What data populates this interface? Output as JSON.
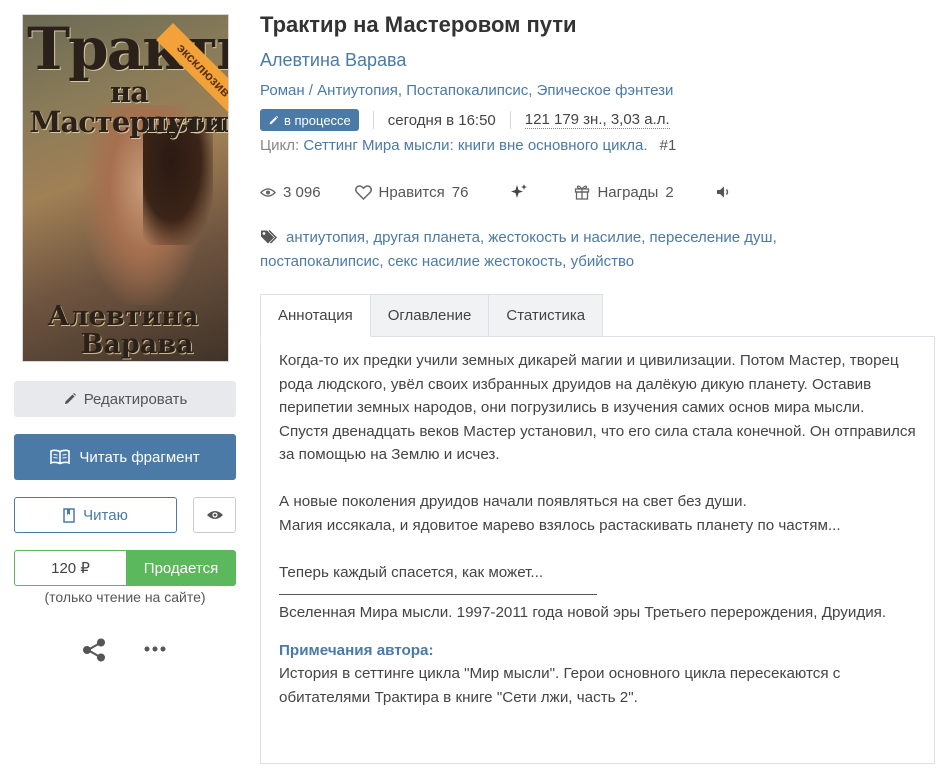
{
  "book": {
    "title": "Трактир на Мастеровом пути",
    "author": "Алевтина Варава",
    "genres": [
      "Роман",
      "Антиутопия",
      "Постапокалипсис",
      "Эпическое фэнтези"
    ],
    "status": "в процессе",
    "updated": "сегодня в 16:50",
    "size": "121 179 зн., 3,03 а.л.",
    "cycle_label": "Цикл:",
    "cycle_name": "Сеттинг Мира мысли: книги вне основного цикла.",
    "cycle_num": "#1"
  },
  "cover": {
    "line1": "Трактир",
    "line2": "на Мастеровом",
    "line3": "пути",
    "author1": "Алевтина",
    "author2": "Варава",
    "ribbon": "эксклюзив"
  },
  "stats": {
    "views": "3 096",
    "likes_label": "Нравится",
    "likes": "76",
    "awards_label": "Награды",
    "awards": "2"
  },
  "tags": [
    "антиутопия",
    "другая планета",
    "жестокость и насилие",
    "переселение душ",
    "постапокалипсис",
    "секс насилие жестокость",
    "убийство"
  ],
  "actions": {
    "edit": "Редактировать",
    "read_fragment": "Читать фрагмент",
    "reading": "Читаю",
    "price": "120 ₽",
    "buy": "Продается",
    "price_note": "(только чтение на сайте)"
  },
  "tabs": [
    "Аннотация",
    "Оглавление",
    "Статистика"
  ],
  "annotation": {
    "p1": "Когда-то их предки учили земных дикарей магии и цивилизации. Потом Мастер, творец рода людского, увёл своих избранных друидов на далёкую дикую планету. Оставив перипетии земных народов, они погрузились в изучения самих основ мира мысли.",
    "p2": "Спустя двенадцать веков Мастер установил, что его сила стала конечной. Он отправился за помощью на Землю и исчез.",
    "p3": "А новые поколения друидов начали появляться на свет без души.",
    "p4": "Магия иссякала, и ядовитое марево взялось растаскивать планету по частям...",
    "p5": "Теперь каждый спасется, как может...",
    "p6": "Вселенная Мира мысли. 1997-2011 года новой эры Третьего перерождения, Друидия.",
    "notes_heading": "Примечания автора:",
    "notes": "История в сеттинге цикла \"Мир мысли\". Герои основного цикла пересекаются с обитателями Трактира в книге \"Сети лжи, часть 2\"."
  },
  "colors": {
    "accent": "#4a7aa5",
    "buy": "#5cb85c",
    "ribbon": "#f2a238"
  }
}
